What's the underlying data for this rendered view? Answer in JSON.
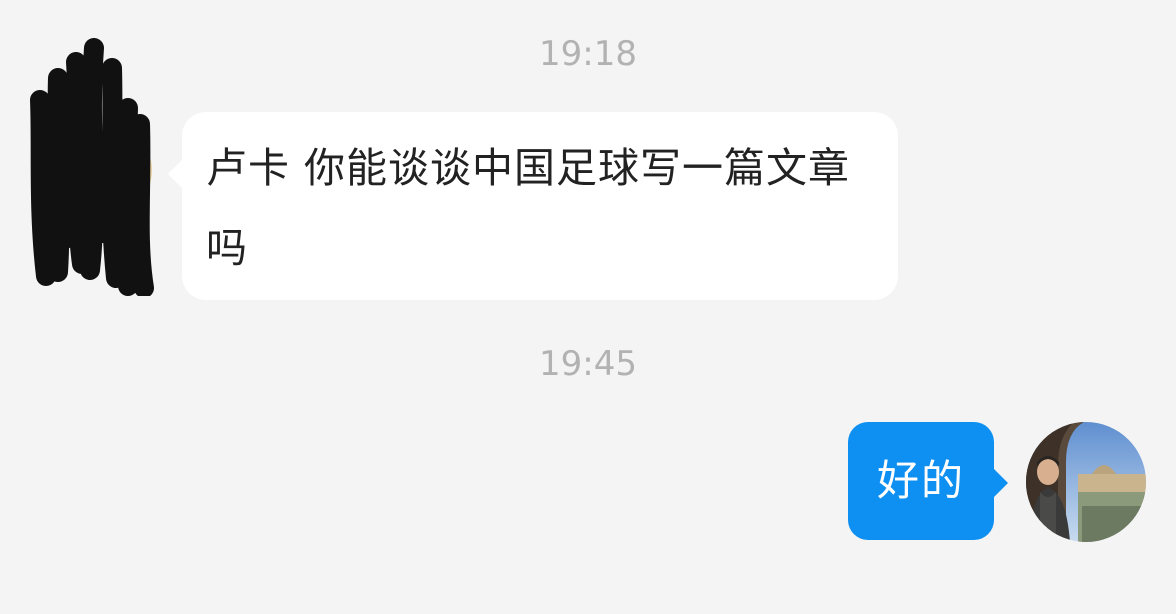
{
  "chat": {
    "timestamps": [
      "19:18",
      "19:45"
    ],
    "messages": [
      {
        "direction": "incoming",
        "text": "卢卡 你能谈谈中国足球写一篇文章吗",
        "avatar": "redacted-avatar-icon"
      },
      {
        "direction": "outgoing",
        "text": "好的",
        "avatar": "user-photo-avatar"
      }
    ]
  },
  "colors": {
    "background": "#f4f4f4",
    "incoming_bubble": "#ffffff",
    "outgoing_bubble": "#0e8ff2",
    "timestamp": "#b2b2b2"
  }
}
